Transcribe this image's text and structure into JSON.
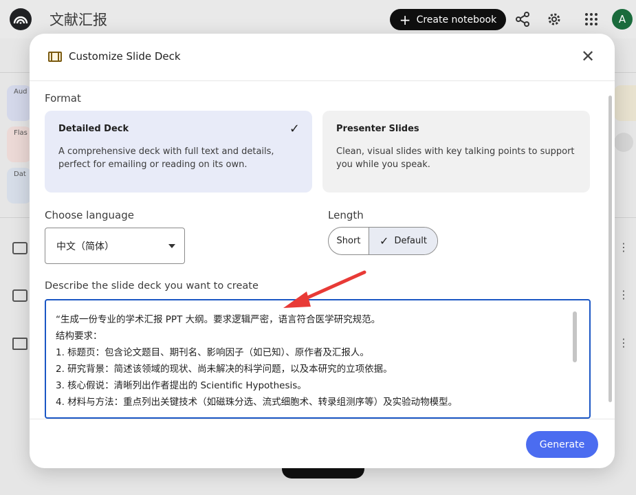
{
  "app": {
    "notebook_title": "文献汇报",
    "create_notebook_label": "Create notebook",
    "avatar_initial": "A",
    "bg_chips": [
      "Aud",
      "Flas",
      "Dat"
    ]
  },
  "modal": {
    "title": "Customize Slide Deck",
    "format_label": "Format",
    "formats": [
      {
        "title": "Detailed Deck",
        "desc": "A comprehensive deck with full text and details, perfect for emailing or reading on its own.",
        "selected": true
      },
      {
        "title": "Presenter Slides",
        "desc": "Clean, visual slides with key talking points to support you while you speak.",
        "selected": false
      }
    ],
    "language_label": "Choose language",
    "language_value": "中文（简体）",
    "length_label": "Length",
    "length_options": [
      "Short",
      "Default"
    ],
    "length_selected": "Default",
    "describe_label": "Describe the slide deck you want to create",
    "prompt_lines": [
      "“生成一份专业的学术汇报 PPT 大纲。要求逻辑严密，语言符合医学研究规范。",
      "结构要求：",
      "1. 标题页：包含论文题目、期刊名、影响因子（如已知）、原作者及汇报人。",
      "2. 研究背景：简述该领域的现状、尚未解决的科学问题，以及本研究的立项依据。",
      "3. 核心假说：清晰列出作者提出的 Scientific Hypothesis。",
      "4. 材料与方法：重点列出关键技术（如磁珠分选、流式细胞术、转录组测序等）及实验动物模型。"
    ],
    "generate_label": "Generate"
  },
  "colors": {
    "accent": "#4b6cf0",
    "selected_card": "#e8ebf8",
    "focus_border": "#1a56c4",
    "annotation_arrow": "#e83a36"
  }
}
